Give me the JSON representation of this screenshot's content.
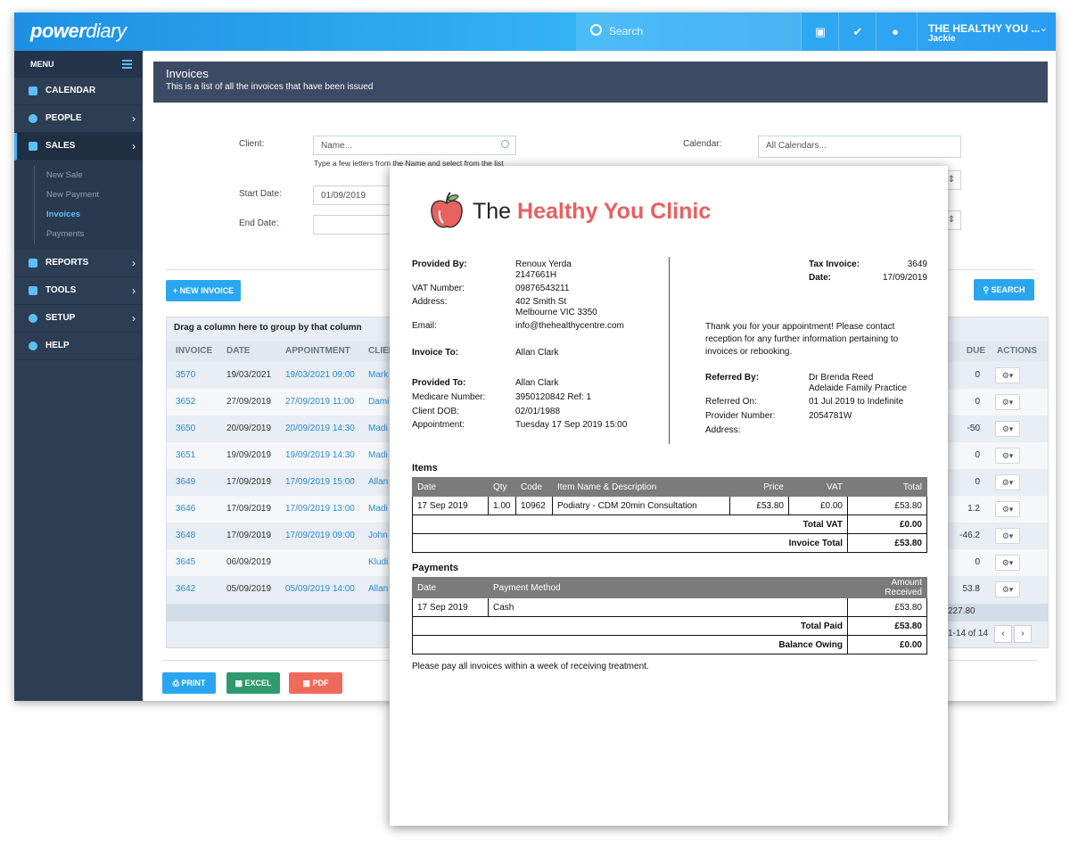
{
  "topbar": {
    "logo_a": "power",
    "logo_b": "diary",
    "search_placeholder": "Search",
    "practice": "THE HEALTHY YOU ...",
    "user": "Jackie"
  },
  "sidebar": {
    "menu_label": "MENU",
    "items": [
      {
        "label": "CALENDAR"
      },
      {
        "label": "PEOPLE"
      },
      {
        "label": "SALES"
      }
    ],
    "sales_sub": [
      "New Sale",
      "New Payment",
      "Invoices",
      "Payments"
    ],
    "items2": [
      {
        "label": "REPORTS"
      },
      {
        "label": "TOOLS"
      },
      {
        "label": "SETUP"
      },
      {
        "label": "HELP"
      }
    ]
  },
  "page": {
    "title": "Invoices",
    "subtitle": "This is a list of all the invoices that have been issued"
  },
  "filters": {
    "client_label": "Client:",
    "client_placeholder": "Name...",
    "client_hint": "Type a few letters from the Name and select from the list",
    "calendar_label": "Calendar:",
    "calendar_value": "All Calendars...",
    "start_label": "Start Date:",
    "start_value": "01/09/2019",
    "end_label": "End Date:"
  },
  "buttons": {
    "new_invoice": "+ NEW INVOICE",
    "search": "SEARCH",
    "print": "PRINT",
    "excel": "EXCEL",
    "pdf": "PDF"
  },
  "grid": {
    "group_hint": "Drag a column here to group by that column",
    "headers": {
      "invoice": "INVOICE",
      "date": "DATE",
      "appointment": "APPOINTMENT",
      "client": "CLIEN",
      "due": "DUE",
      "actions": "ACTIONS"
    },
    "rows": [
      {
        "invoice": "3570",
        "date": "19/03/2021",
        "appt": "19/03/2021 09:00",
        "client": "Mark",
        "due": "0"
      },
      {
        "invoice": "3652",
        "date": "27/09/2019",
        "appt": "27/09/2019 11:00",
        "client": "Dami",
        "due": "0"
      },
      {
        "invoice": "3650",
        "date": "20/09/2019",
        "appt": "20/09/2019 14:30",
        "client": "Madi",
        "due": "-50"
      },
      {
        "invoice": "3651",
        "date": "19/09/2019",
        "appt": "19/09/2019 14:30",
        "client": "Madi",
        "due": "0"
      },
      {
        "invoice": "3649",
        "date": "17/09/2019",
        "appt": "17/09/2019 15:00",
        "client": "Allan",
        "due": "0"
      },
      {
        "invoice": "3646",
        "date": "17/09/2019",
        "appt": "17/09/2019 13:00",
        "client": "Madi",
        "due": "1.2"
      },
      {
        "invoice": "3648",
        "date": "17/09/2019",
        "appt": "17/09/2019 09:00",
        "client": "John",
        "due": "-46.2"
      },
      {
        "invoice": "3645",
        "date": "06/09/2019",
        "appt": "",
        "client": "Kludi",
        "due": "0"
      },
      {
        "invoice": "3642",
        "date": "05/09/2019",
        "appt": "05/09/2019 14:00",
        "client": "Allan",
        "due": "53.8"
      }
    ],
    "total_due": "227.80",
    "pager_text": "1-14 of 14"
  },
  "invoice": {
    "clinic_the": "The",
    "clinic_name": "Healthy You Clinic",
    "provided_by_label": "Provided By:",
    "provided_by": "Renoux Yerda",
    "provided_by_no": "2147661H",
    "vat_label": "VAT Number:",
    "vat": "09876543211",
    "address_label": "Address:",
    "address1": "402 Smith St",
    "address2": "Melbourne VIC 3350",
    "email_label": "Email:",
    "email": "info@thehealthycentre.com",
    "invoice_to_label": "Invoice To:",
    "invoice_to": "Allan Clark",
    "provided_to_label": "Provided To:",
    "provided_to": "Allan Clark",
    "medicare_label": "Medicare Number:",
    "medicare": "3950120842 Ref: 1",
    "dob_label": "Client DOB:",
    "dob": "02/01/1988",
    "appt_label": "Appointment:",
    "appt": "Tuesday 17 Sep 2019 15:00",
    "tax_invoice_label": "Tax Invoice:",
    "tax_invoice": "3649",
    "date_label": "Date:",
    "date": "17/09/2019",
    "thanks": [
      "Thank you for your appointment! Please contact",
      "reception for any further information pertaining to",
      "invoices or rebooking."
    ],
    "referred_by_label": "Referred By:",
    "referred_by": "Dr Brenda Reed",
    "referred_by_2": "Adelaide Family Practice",
    "referred_on_label": "Referred On:",
    "referred_on": "01 Jul 2019 to Indefinite",
    "provider_no_label": "Provider Number:",
    "provider_no": "2054781W",
    "ref_address_label": "Address:",
    "items_title": "Items",
    "items_headers": {
      "date": "Date",
      "qty": "Qty",
      "code": "Code",
      "name": "Item Name & Description",
      "price": "Price",
      "vat": "VAT",
      "total": "Total"
    },
    "item": {
      "date": "17 Sep 2019",
      "qty": "1.00",
      "code": "10962",
      "name": "Podiatry - CDM 20min Consultation",
      "price": "£53.80",
      "vat": "£0.00",
      "total": "£53.80"
    },
    "total_vat_label": "Total VAT",
    "total_vat": "£0.00",
    "invoice_total_label": "Invoice Total",
    "invoice_total": "£53.80",
    "payments_title": "Payments",
    "pay_headers": {
      "date": "Date",
      "method": "Payment Method",
      "amount": "Amount Received"
    },
    "payment": {
      "date": "17 Sep 2019",
      "method": "Cash",
      "amount": "£53.80"
    },
    "total_paid_label": "Total Paid",
    "total_paid": "£53.80",
    "balance_label": "Balance Owing",
    "balance": "£0.00",
    "footer_note": "Please pay all invoices within a week of receiving treatment."
  }
}
